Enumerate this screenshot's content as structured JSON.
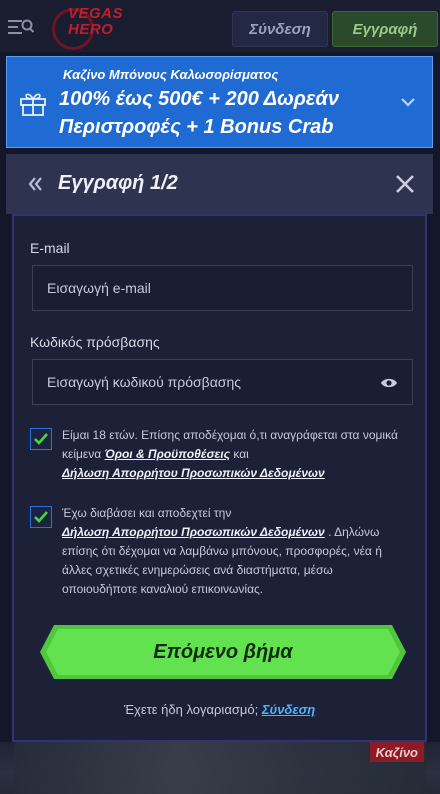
{
  "header": {
    "logo_line1": "Vegas",
    "logo_line2": "Hero",
    "login_label": "Σύνδεση",
    "register_label": "Εγγραφή"
  },
  "banner": {
    "subtitle": "Καζίνο Μπόνους Καλωσορίσματος",
    "headline": "100% έως 500€ + 200 Δωρεάν Περιστροφές + 1 Bonus Crab"
  },
  "form_header": {
    "title": "Εγγραφή 1/2"
  },
  "form": {
    "email_label": "E-mail",
    "email_placeholder": "Εισαγωγή e-mail",
    "password_label": "Κωδικός πρόσβασης",
    "password_placeholder": "Εισαγωγή κωδικού πρόσβασης",
    "consent1_text": "Είμαι 18 ετών. Επίσης αποδέχομαι ό,τι αναγράφεται στα νομικά κείμενα",
    "consent1_link1": "Όροι & Προϋποθέσεις",
    "consent1_and": "και",
    "consent1_link2": "Δήλωση Απορρήτου Προσωπικών Δεδομένων",
    "consent1_checked": true,
    "consent2_text_before": "Έχω διαβάσει και αποδεχτεί την",
    "consent2_link": "Δήλωση Απορρήτου Προσωπικών Δεδομένων",
    "consent2_text_after": ". Δηλώνω επίσης ότι δέχομαι να λαμβάνω μπόνους, προσφορές, νέα ή άλλες σχετικές ενημερώσεις ανά διαστήματα, μέσω οποιουδήποτε καναλιού επικοινωνίας.",
    "consent2_checked": true,
    "next_label": "Επόμενο βήμα",
    "have_account_text": "Έχετε ήδη λογαριασμό;",
    "login_link": "Σύνδεση"
  },
  "background": {
    "casino_tag": "Καζίνο"
  },
  "colors": {
    "background": "#14172a",
    "banner_blue": "#1f6bd3",
    "panel": "#1d2137",
    "panel_border": "#2f3574",
    "button_green": "#5ee04a",
    "check_green": "#3ddc3d",
    "link_blue": "#4fb3ff",
    "casino_red": "#8c1b26"
  },
  "icons": [
    "menu-search-icon",
    "gift-icon",
    "chevron-down-icon",
    "chevron-left-icon",
    "close-icon",
    "eye-icon",
    "check-icon"
  ]
}
